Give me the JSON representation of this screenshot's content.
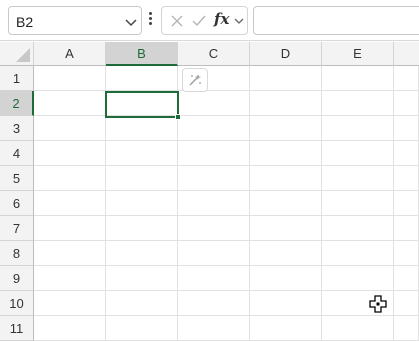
{
  "name_box": {
    "value": "B2"
  },
  "formula_bar": {
    "fx_label": "fx",
    "formula_value": ""
  },
  "icons": {
    "name_box_dropdown": "chevron-down-icon",
    "more_options": "vertical-dots-icon",
    "cancel": "x-icon",
    "enter": "check-icon",
    "fx_dropdown": "chevron-down-icon",
    "quick_analysis": "sparkle-icon",
    "cursor": "move-cursor-icon"
  },
  "columns": [
    "A",
    "B",
    "C",
    "D",
    "E"
  ],
  "rows": [
    "1",
    "2",
    "3",
    "4",
    "5",
    "6",
    "7",
    "8",
    "9",
    "10",
    "11"
  ],
  "active_cell": {
    "column": "B",
    "row": "2"
  },
  "colors": {
    "accent": "#1e6b3a",
    "header_bg": "#f3f3f3",
    "header_active_bg": "#d3d3d3",
    "gridline": "#e1e1e1"
  }
}
